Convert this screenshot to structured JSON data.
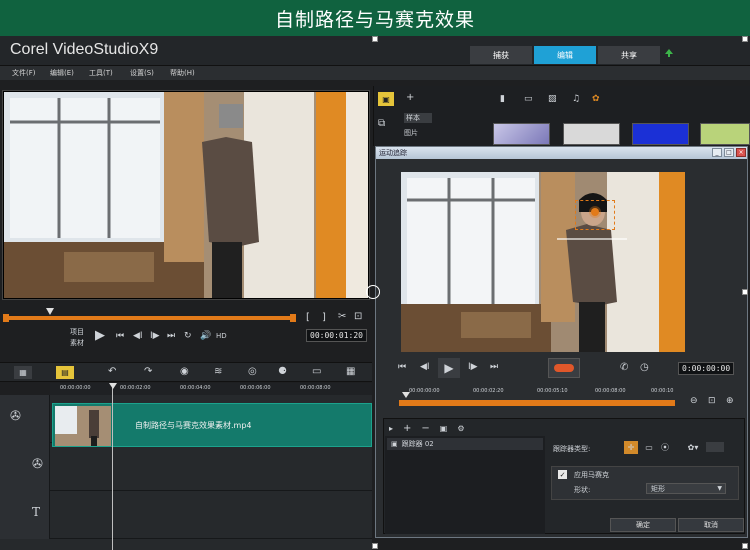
{
  "banner": {
    "title": "自制路径与马赛克效果"
  },
  "app": {
    "title": "Corel VideoStudioX9"
  },
  "workspace_tabs": [
    {
      "label": "捕获"
    },
    {
      "label": "编辑"
    },
    {
      "label": "共享"
    }
  ],
  "menu": [
    "文件(F)",
    "编辑(E)",
    "工具(T)",
    "设置(S)",
    "帮助(H)"
  ],
  "player": {
    "mode_labels": {
      "project": "项目",
      "clip": "素材"
    },
    "hd": "HD",
    "timecode": "00:00:01:20"
  },
  "timeline": {
    "clip_name": "自制路径与马赛克效果素材.mp4",
    "ruler_ticks": [
      "00:00:00:00",
      "00:00:02:00",
      "00:00:04:00",
      "00:00:06:00",
      "00:00:08:00",
      "00:00:10:00"
    ]
  },
  "library": {
    "categories": [
      {
        "label": "样本"
      },
      {
        "label": "图片"
      }
    ]
  },
  "dialog": {
    "title": "运动追踪",
    "window_buttons": [
      "_",
      "□",
      "×"
    ],
    "timecode": "0:00:00:00",
    "ruler_ticks": [
      "00:00:00:00",
      "00:00:02:20",
      "00:00:05:10",
      "00:00:08:00",
      "00:00:10"
    ],
    "object_name": "跟踪器 02",
    "tracker_type_label": "跟踪器类型:",
    "apply_mosaic_label": "应用马赛克",
    "shape_label": "形状:",
    "shape_value": "矩形",
    "ok_label": "确定",
    "cancel_label": "取消"
  },
  "colors": {
    "banner": "#10623f",
    "accent": "#1fa1d6",
    "progress": "#e27a19",
    "clip": "#147a6b"
  }
}
